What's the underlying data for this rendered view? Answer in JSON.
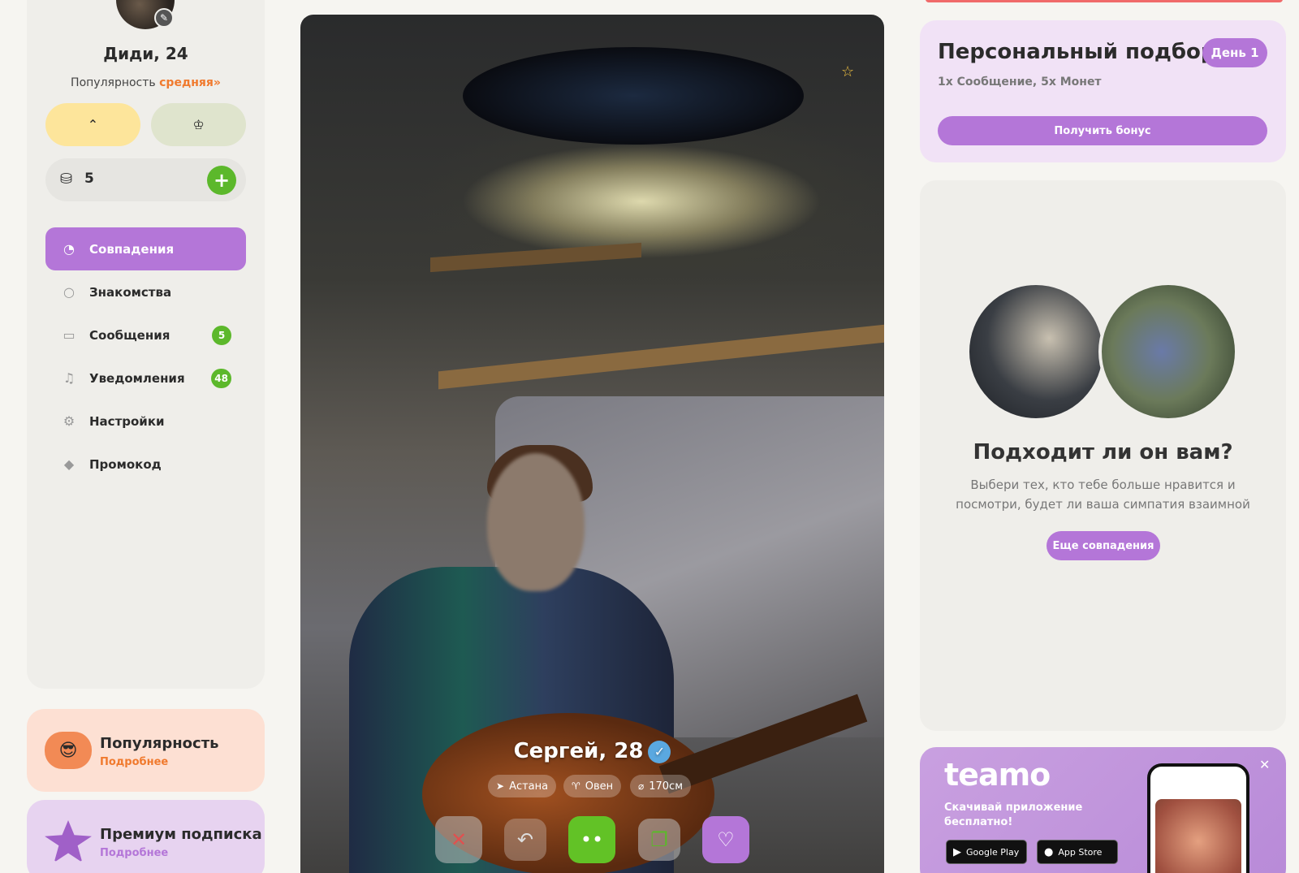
{
  "user": {
    "name": "Диди, 24",
    "popularity_label": "Популярность",
    "popularity_level": "средняя",
    "coins": "5"
  },
  "nav": {
    "items": [
      {
        "label": "Совпадения",
        "icon": "matches-icon"
      },
      {
        "label": "Знакомства",
        "icon": "search-icon"
      },
      {
        "label": "Сообщения",
        "icon": "messages-icon",
        "badge": "5"
      },
      {
        "label": "Уведомления",
        "icon": "bell-icon",
        "badge": "48"
      },
      {
        "label": "Настройки",
        "icon": "gear-icon"
      },
      {
        "label": "Промокод",
        "icon": "tag-icon"
      }
    ]
  },
  "promos": {
    "popularity": {
      "title": "Популярность",
      "link": "Подробнее"
    },
    "premium": {
      "title": "Премиум подписка",
      "link": "Подробнее"
    }
  },
  "profile": {
    "name": "Сергей, 28",
    "tags": [
      {
        "label": "Астана",
        "icon": "location-icon"
      },
      {
        "label": "Овен",
        "icon": "aries-icon"
      },
      {
        "label": "170см",
        "icon": "ruler-icon"
      }
    ]
  },
  "bonus": {
    "title": "Персональный подбор",
    "day": "День 1",
    "subtitle": "1х Сообщение, 5х Монет",
    "button": "Получить бонус"
  },
  "match_card": {
    "title": "Подходит ли он вам?",
    "text": "Выбери тех, кто тебе больше нравится и посмотри, будет ли ваша симпатия взаимной",
    "button": "Еще совпадения"
  },
  "app_promo": {
    "logo": "teamo",
    "text": "Скачивай приложение бесплатно!",
    "google_play": "Google Play",
    "app_store": "App Store"
  },
  "colors": {
    "accent": "#b476d8",
    "green": "#5cb82b",
    "orange": "#f07a2e"
  }
}
